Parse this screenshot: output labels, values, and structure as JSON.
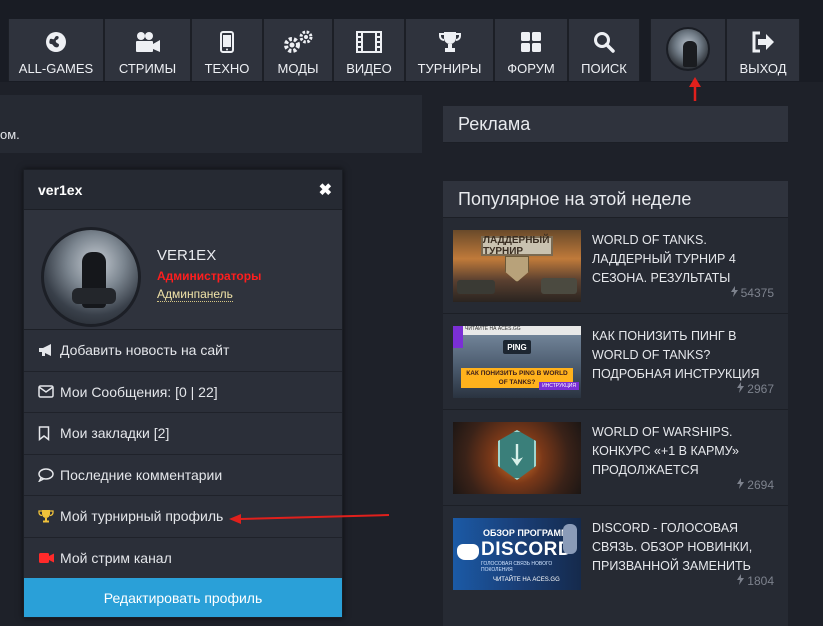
{
  "nav": {
    "items": [
      {
        "label": "ALL-GAMES",
        "icon": "globe-icon"
      },
      {
        "label": "СТРИМЫ",
        "icon": "video-camera-icon"
      },
      {
        "label": "ТЕХНО",
        "icon": "mobile-phone-icon"
      },
      {
        "label": "МОДЫ",
        "icon": "gears-icon"
      },
      {
        "label": "ВИДЕО",
        "icon": "film-icon"
      },
      {
        "label": "ТУРНИРЫ",
        "icon": "trophy-icon"
      },
      {
        "label": "ФОРУМ",
        "icon": "grid-icon"
      },
      {
        "label": "ПОИСК",
        "icon": "search-icon"
      }
    ],
    "logout_label": "ВЫХОД",
    "logout_icon": "sign-out-icon"
  },
  "article": {
    "text_fragment": "ом."
  },
  "profile_popup": {
    "username": "ver1ex",
    "display_name": "VER1EX",
    "group": "Администраторы",
    "admin_link": "Админпанель",
    "menu": [
      {
        "label": "Добавить новость на сайт",
        "icon": "megaphone-icon"
      },
      {
        "label": "Мои Сообщения: [0 | 22]",
        "icon": "envelope-icon"
      },
      {
        "label": "Мои закладки [2]",
        "icon": "bookmark-icon"
      },
      {
        "label": "Последние комментарии",
        "icon": "comment-icon"
      },
      {
        "label": "Мой турнирный профиль",
        "icon": "trophy-icon"
      },
      {
        "label": "Мой стрим канал",
        "icon": "video-camera-icon"
      }
    ],
    "edit_button": "Редактировать профиль"
  },
  "sidebar": {
    "ads_title": "Реклама",
    "popular_title": "Популярное на этой неделе",
    "popular": [
      {
        "title": "WORLD OF TANKS. ЛАДДЕРНЫЙ ТУРНИР 4 СЕЗОНА. РЕЗУЛЬТАТЫ",
        "views": "54375",
        "thumb_text": "ЛАДДЕРНЫЙ ТУРНИР"
      },
      {
        "title": "КАК ПОНИЗИТЬ ПИНГ В WORLD OF TANKS? ПОДРОБНАЯ ИНСТРУКЦИЯ",
        "views": "2967",
        "thumb_text": "КАК ПОНИЗИТЬ PING В WORLD OF TANKS?",
        "thumb_badge": "ИНСТРУКЦИЯ",
        "thumb_ping": "PING",
        "thumb_top": "ЧИТАЙТЕ НА ACES.GG"
      },
      {
        "title": "WORLD OF WARSHIPS. КОНКУРС «+1 В КАРМУ» ПРОДОЛЖАЕТСЯ",
        "views": "2694"
      },
      {
        "title": "DISCORD - ГОЛОСОВАЯ СВЯЗЬ. ОБЗОР НОВИНКИ, ПРИЗВАННОЙ ЗАМЕНИТЬ",
        "views": "1804",
        "thumb_t1": "ОБЗОР ПРОГРАММЫ",
        "thumb_t2": "DISCORD",
        "thumb_t3": "ГОЛОСОВАЯ СВЯЗЬ НОВОГО ПОКОЛЕНИЯ",
        "thumb_t4": "ЧИТАЙТЕ НА ACES.GG"
      }
    ]
  },
  "colors": {
    "accent": "#2aa0d8",
    "group_red": "#ff1e1e",
    "annotation_red": "#e0201c"
  }
}
